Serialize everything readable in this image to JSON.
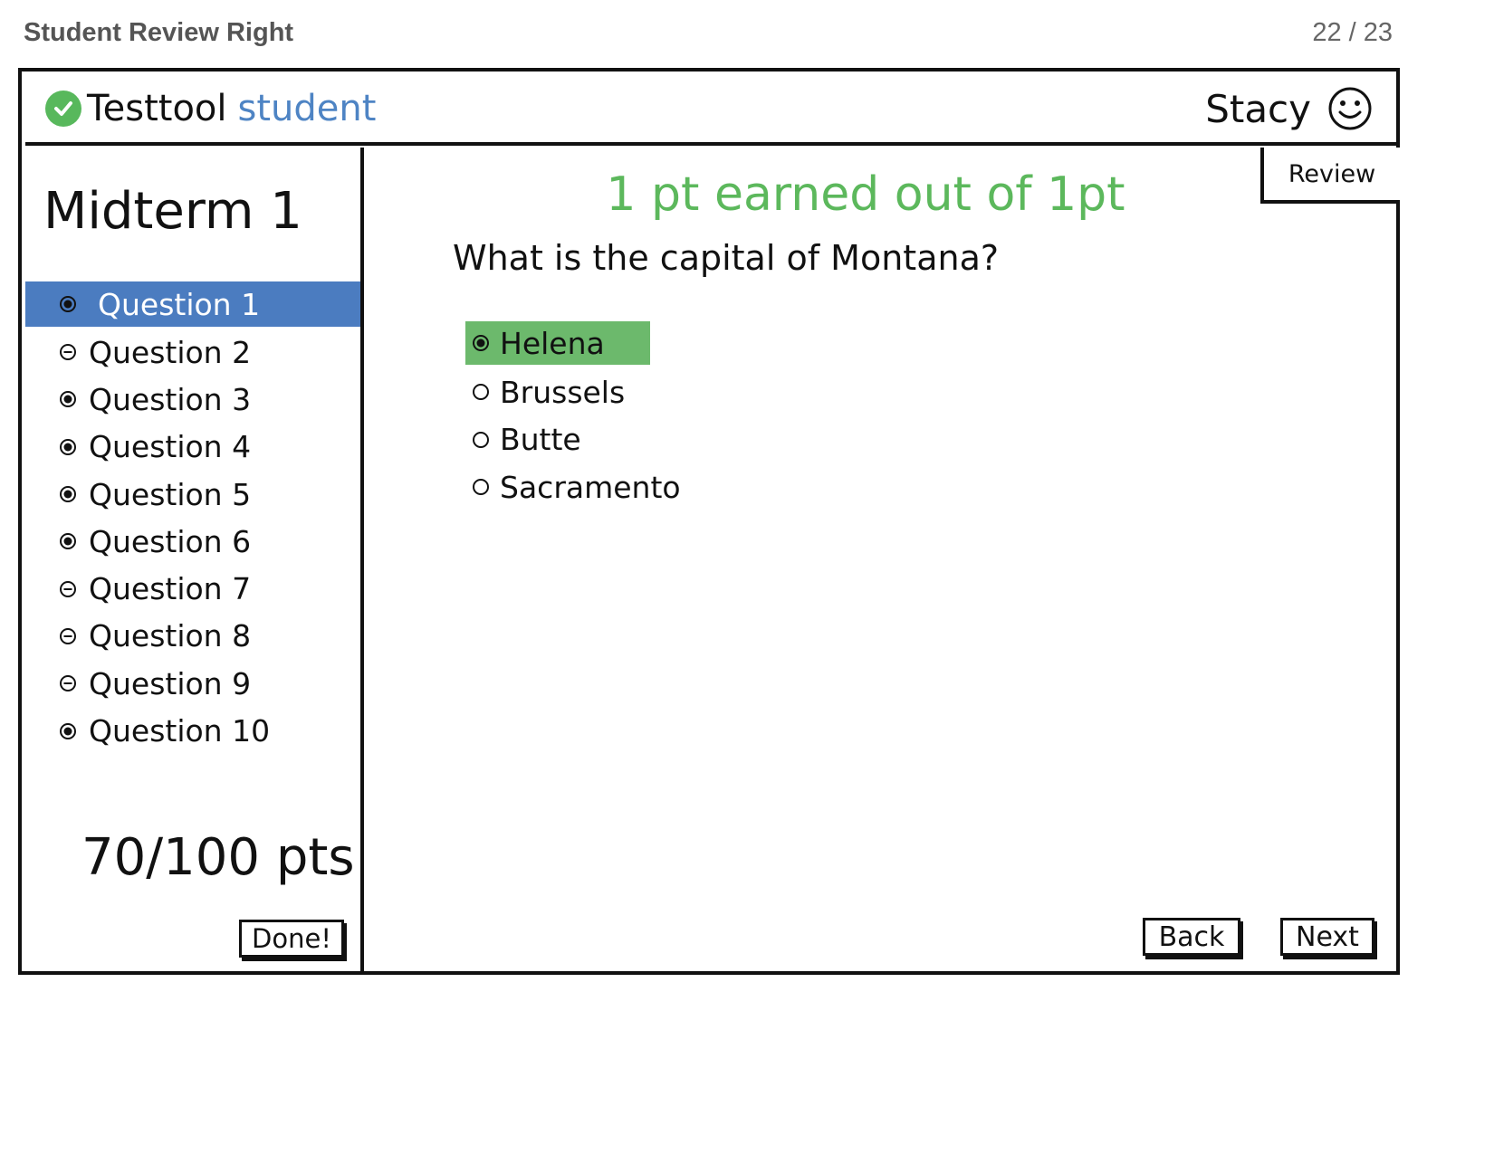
{
  "page": {
    "title": "Student Review Right",
    "counter": "22 / 23"
  },
  "header": {
    "app_name": "Testtool",
    "app_role": "student",
    "user_name": "Stacy"
  },
  "sidebar": {
    "exam_title": "Midterm 1",
    "questions": [
      {
        "label": "Question 1",
        "status": "answered",
        "active": true
      },
      {
        "label": "Question 2",
        "status": "unanswered"
      },
      {
        "label": "Question 3",
        "status": "answered"
      },
      {
        "label": "Question 4",
        "status": "answered"
      },
      {
        "label": "Question 5",
        "status": "answered"
      },
      {
        "label": "Question 6",
        "status": "answered"
      },
      {
        "label": "Question 7",
        "status": "unanswered"
      },
      {
        "label": "Question 8",
        "status": "unanswered"
      },
      {
        "label": "Question 9",
        "status": "unanswered"
      },
      {
        "label": "Question 10",
        "status": "answered"
      }
    ],
    "score": "70/100 pts",
    "done_label": "Done!"
  },
  "main": {
    "review_tab": "Review",
    "score_line": "1 pt earned out of 1pt",
    "question": "What is the capital of Montana?",
    "options": [
      {
        "label": "Helena",
        "selected": true
      },
      {
        "label": "Brussels",
        "selected": false
      },
      {
        "label": "Butte",
        "selected": false
      },
      {
        "label": "Sacramento",
        "selected": false
      }
    ],
    "back_label": "Back",
    "next_label": "Next"
  },
  "colors": {
    "accent_blue": "#4b7cc0",
    "role_blue": "#4e84c4",
    "correct_green": "#5cb85c",
    "selected_green": "#6cb96c",
    "logo_green": "#58b85c"
  },
  "icons": {
    "answered": "radio-filled-icon",
    "unanswered": "minus-circle-icon",
    "option_selected": "radio-filled-icon",
    "option_unselected": "radio-empty-icon"
  }
}
